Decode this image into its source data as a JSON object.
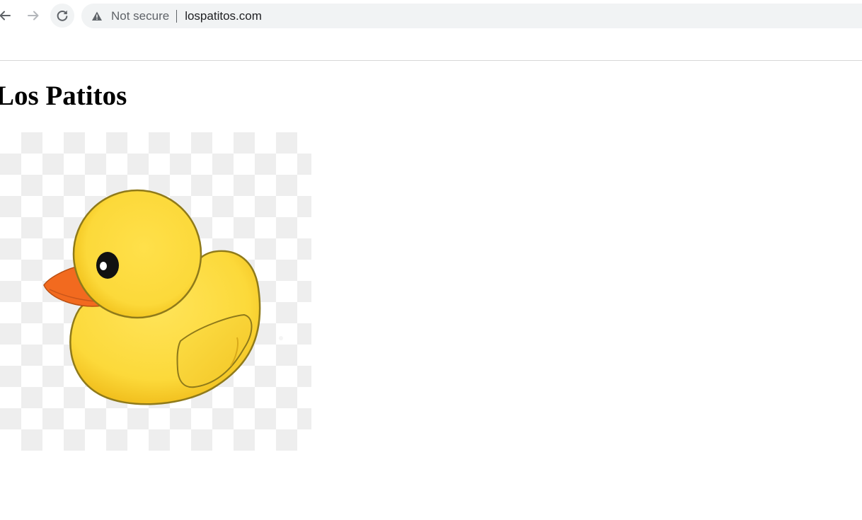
{
  "browser": {
    "security_label": "Not secure",
    "url": "lospatitos.com",
    "icons": {
      "back": "arrow-left-icon",
      "forward": "arrow-right-icon",
      "reload": "reload-icon",
      "security": "warning-triangle-icon"
    }
  },
  "page": {
    "heading": "Los Patitos",
    "image": {
      "subject": "duck-illustration",
      "colors": {
        "body": "#fcd93a",
        "outline": "#8f7a1a",
        "beak": "#f26a1f",
        "eye": "#111111"
      }
    }
  }
}
